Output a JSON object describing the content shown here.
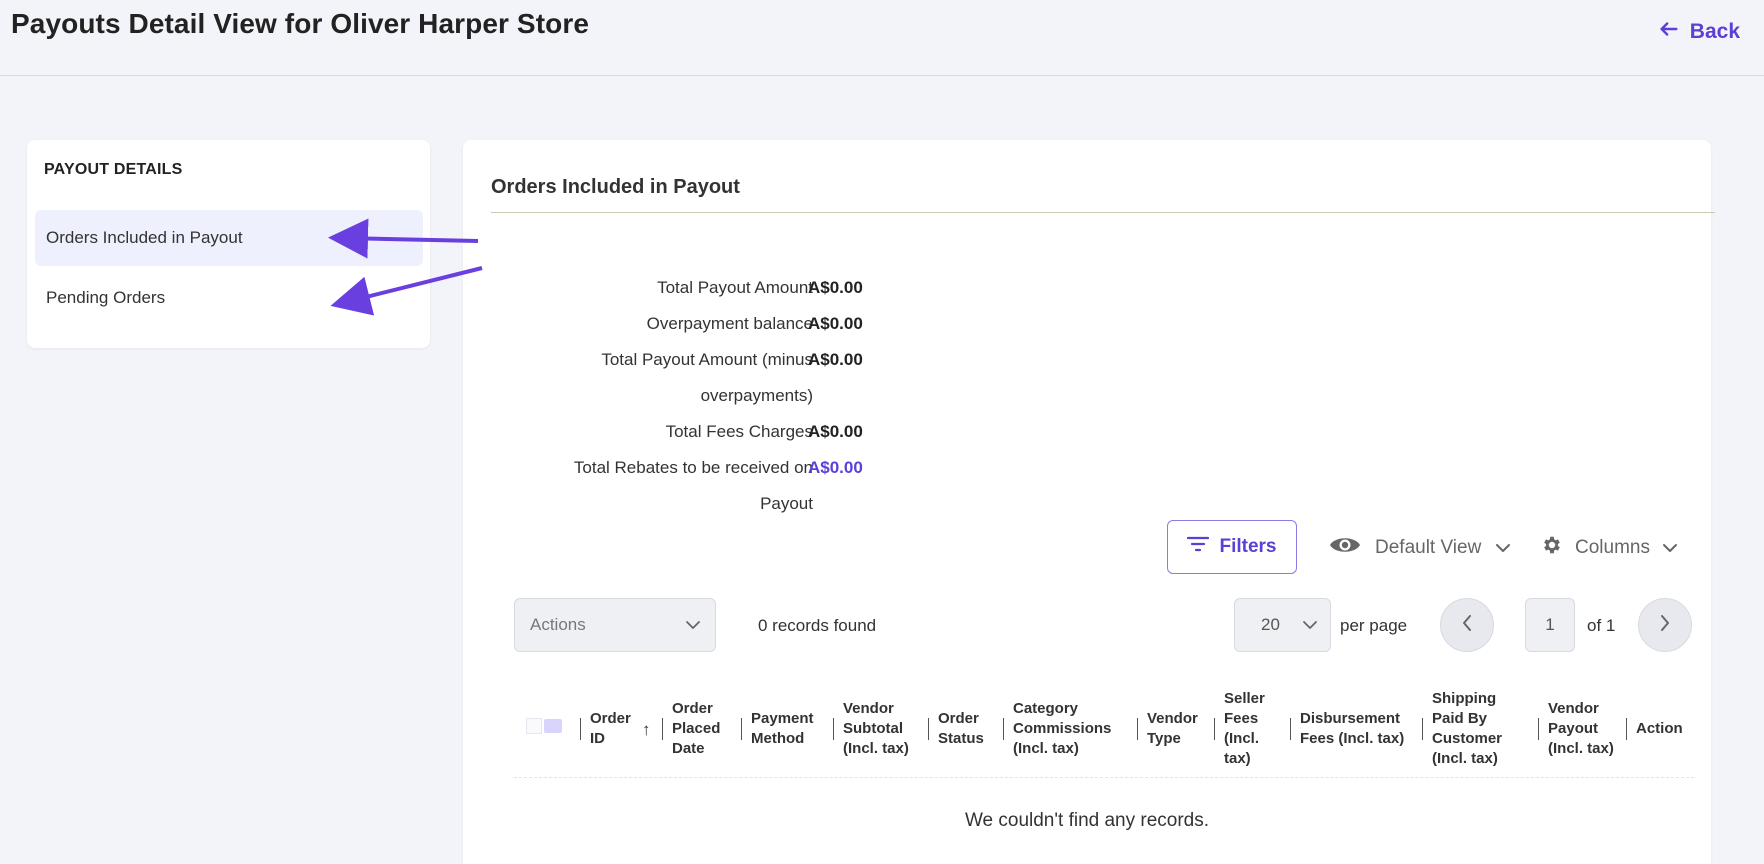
{
  "header": {
    "title": "Payouts Detail View for Oliver Harper Store",
    "back_label": "Back"
  },
  "sidebar": {
    "heading": "PAYOUT DETAILS",
    "items": [
      {
        "label": "Orders Included in Payout",
        "active": true
      },
      {
        "label": "Pending Orders",
        "active": false
      }
    ]
  },
  "main": {
    "section_title": "Orders Included in Payout",
    "summary": [
      {
        "label": "Total Payout Amount",
        "value": "A$0.00"
      },
      {
        "label": "Overpayment balance",
        "value": "A$0.00"
      },
      {
        "label": "Total Payout Amount (minus overpayments)",
        "value": "A$0.00"
      },
      {
        "label": "Total Fees Charges",
        "value": "A$0.00"
      },
      {
        "label": "Total Rebates to be received on Payout",
        "value": "A$0.00"
      }
    ],
    "toolbar": {
      "filters_label": "Filters",
      "view_label": "Default View",
      "columns_label": "Columns"
    },
    "list_controls": {
      "actions_placeholder": "Actions",
      "records_found": "0 records found",
      "per_page_value": "20",
      "per_page_label": "per page",
      "page_value": "1",
      "page_of": "of 1"
    },
    "table": {
      "columns": [
        "Order ID",
        "Order Placed Date",
        "Payment Method",
        "Vendor Subtotal (Incl. tax)",
        "Order Status",
        "Category Commissions (Incl. tax)",
        "Vendor Type",
        "Seller Fees (Incl. tax)",
        "Disbursement Fees (Incl. tax)",
        "Shipping Paid By Customer (Incl. tax)",
        "Vendor Payout (Incl. tax)",
        "Action"
      ],
      "sort_indicator": "↑",
      "empty_message": "We couldn't find any records."
    }
  },
  "colors": {
    "accent": "#5b3fd6",
    "arrow": "#6a3fe0"
  }
}
